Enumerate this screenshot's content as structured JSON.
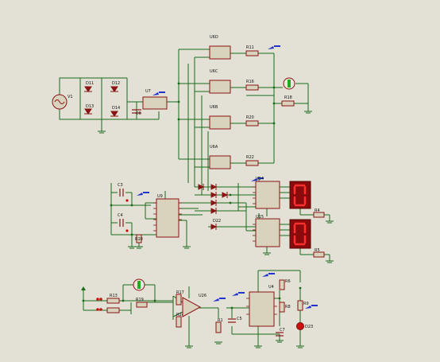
{
  "colors": {
    "background": "#e3e1d6",
    "wire": "#1a6a1a",
    "component": "#8a1414",
    "body_fill": "#d9d3bd",
    "label": "#111111",
    "display_bg": "#8a0b0b",
    "display_seg": "#ff3030",
    "probe": "#2233cc",
    "led": "#cc1010",
    "meter_fill": "#eae8dc",
    "meter_needle": "#22aa22"
  },
  "labels": {
    "v1": "V1",
    "d11": "D11",
    "d12": "D12",
    "d13": "D13",
    "d14": "D14",
    "u7": "U7",
    "c6": "C6",
    "u6d": "U6D",
    "u6c": "U6C",
    "u6b": "U6B",
    "u6a": "U6A",
    "r11": "R11",
    "r16": "R16",
    "r18": "R18",
    "r20": "R20",
    "r22": "R22",
    "u9": "U9",
    "c3": "C3",
    "c4": "C4",
    "r10": "R10",
    "u14": "U14",
    "u15": "U15",
    "r4": "R4",
    "r5": "R5",
    "d22": "D22",
    "r13": "R13",
    "r19": "R19",
    "r17": "R17",
    "r24": "R24",
    "u26": "U26",
    "c5": "C5",
    "r1": "R1",
    "u4": "U4",
    "r6": "R6",
    "r8": "R8",
    "r9": "R9",
    "d23": "D23",
    "c7": "C7"
  }
}
